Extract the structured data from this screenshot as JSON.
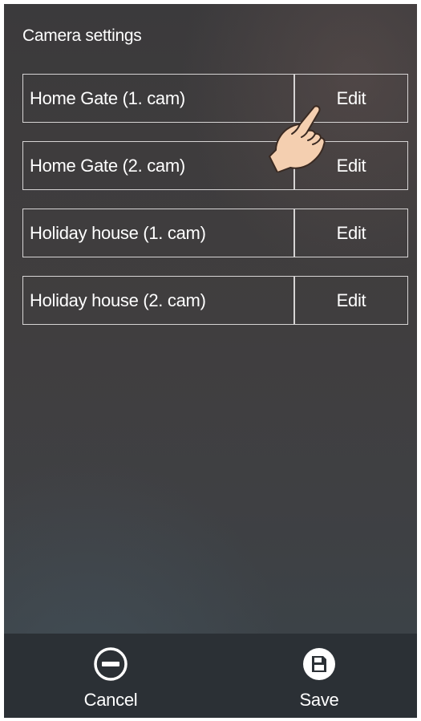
{
  "header": {
    "title": "Camera settings"
  },
  "cameras": [
    {
      "name": "Home Gate (1. cam)",
      "action": "Edit"
    },
    {
      "name": "Home Gate (2. cam)",
      "action": "Edit"
    },
    {
      "name": "Holiday house (1. cam)",
      "action": "Edit"
    },
    {
      "name": "Holiday house (2. cam)",
      "action": "Edit"
    }
  ],
  "footer": {
    "cancel_label": "Cancel",
    "cancel_icon": "minus-circle-icon",
    "save_label": "Save",
    "save_icon": "floppy-disk-icon"
  },
  "colors": {
    "border": "#d6d4d4",
    "footer_bg": "#2b3035",
    "text": "#ffffff"
  }
}
